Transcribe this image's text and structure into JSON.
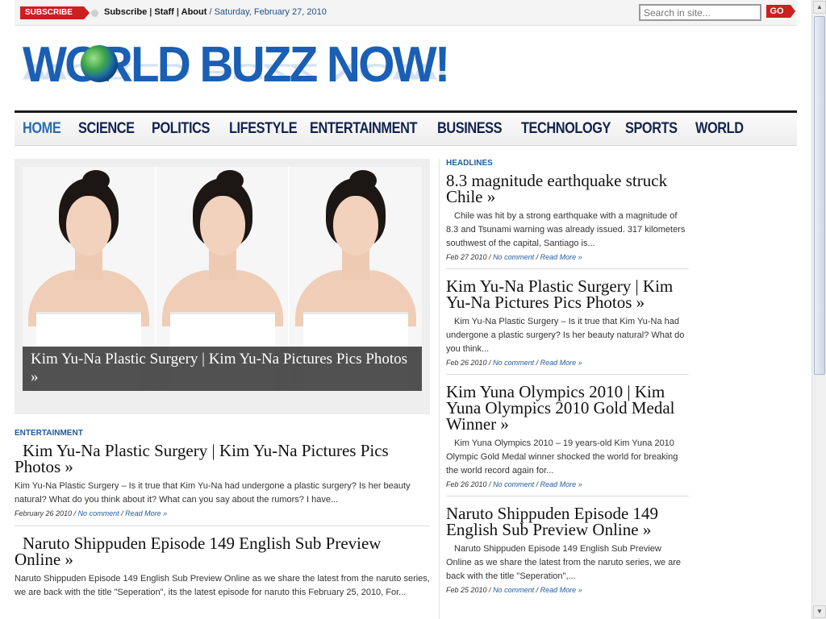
{
  "topbar": {
    "subscribe_badge": "SUBSCRIBE",
    "links": [
      "Subscribe",
      "Staff",
      "About"
    ],
    "date": "Saturday, February 27, 2010",
    "search_placeholder": "Search in site...",
    "go_label": "GO"
  },
  "logo": {
    "text": "WORLD BUZZ NOW!"
  },
  "nav": {
    "items": [
      "HOME",
      "SCIENCE",
      "POLITICS",
      "LIFESTYLE",
      "ENTERTAINMENT",
      "BUSINESS",
      "TECHNOLOGY",
      "SPORTS",
      "WORLD"
    ],
    "active": "HOME"
  },
  "featured": {
    "caption": "Kim Yu-Na Plastic Surgery | Kim Yu-Na Pictures Pics Photos »"
  },
  "left_articles": {
    "category": "ENTERTAINMENT",
    "items": [
      {
        "title": "Kim Yu-Na Plastic Surgery | Kim Yu-Na Pictures Pics Photos »",
        "excerpt": "Kim Yu-Na Plastic Surgery – Is it true that Kim Yu-Na had undergone a plastic surgery? Is her beauty natural? What do you think about it? What can you say about the rumors? I have...",
        "date": "February 26 2010",
        "comment": "No comment",
        "more": "Read More »"
      },
      {
        "title": "Naruto Shippuden Episode 149 English Sub Preview Online »",
        "excerpt": "Naruto Shippuden Episode 149 English Sub Preview Online as we share the latest from the naruto series, we are back with the title \"Seperation\", its the latest episode for naruto this February 25, 2010, For...",
        "date": "",
        "comment": "",
        "more": ""
      }
    ]
  },
  "headlines": {
    "label": "HEADLINES",
    "items": [
      {
        "title": "8.3 magnitude earthquake struck Chile »",
        "excerpt": "Chile was hit by a strong earthquake with a magnitude of 8.3 and Tsunami warning was already issued. 317 kilometers southwest of the capital, Santiago is...",
        "date": "Feb 27 2010",
        "comment": "No comment",
        "more": "Read More »"
      },
      {
        "title": "Kim Yu-Na Plastic Surgery | Kim Yu-Na Pictures Pics Photos »",
        "excerpt": "Kim Yu-Na Plastic Surgery – Is it true that Kim Yu-Na had undergone a plastic surgery? Is her beauty natural? What do you think...",
        "date": "Feb 26 2010",
        "comment": "No comment",
        "more": "Read More »"
      },
      {
        "title": "Kim Yuna Olympics 2010 | Kim Yuna Olympics 2010 Gold Medal Winner »",
        "excerpt": "Kim Yuna Olympics 2010 – 19 years-old Kim Yuna 2010 Olympic Gold Medal winner shocked the world for breaking the world record again for...",
        "date": "Feb 26 2010",
        "comment": "No comment",
        "more": "Read More »"
      },
      {
        "title": "Naruto Shippuden Episode 149 English Sub Preview Online »",
        "excerpt": "Naruto Shippuden Episode 149 English Sub Preview Online as we share the latest from the naruto series, we are back with the title \"Seperation\",...",
        "date": "Feb 25 2010",
        "comment": "No comment",
        "more": "Read More »"
      }
    ]
  },
  "colors": {
    "brand_blue": "#1a5fb4",
    "nav_text": "#13234f",
    "accent_red": "#cc1f1f",
    "link_blue": "#1f5a9c"
  }
}
